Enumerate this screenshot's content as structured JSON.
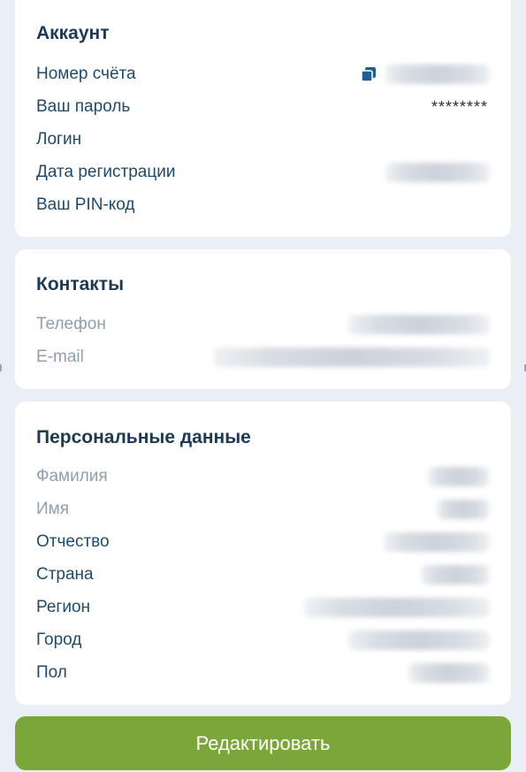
{
  "account": {
    "title": "Аккаунт",
    "rows": [
      {
        "label": "Номер счёта",
        "value": ""
      },
      {
        "label": "Ваш пароль",
        "value": "********"
      },
      {
        "label": "Логин",
        "value": ""
      },
      {
        "label": "Дата регистрации",
        "value": ""
      },
      {
        "label": "Ваш PIN-код",
        "value": ""
      }
    ]
  },
  "contacts": {
    "title": "Контакты",
    "rows": [
      {
        "label": "Телефон",
        "value": ""
      },
      {
        "label": "E-mail",
        "value": ""
      }
    ]
  },
  "personal": {
    "title": "Персональные данные",
    "rows": [
      {
        "label": "Фамилия",
        "value": ""
      },
      {
        "label": "Имя",
        "value": ""
      },
      {
        "label": "Отчество",
        "value": ""
      },
      {
        "label": "Страна",
        "value": ""
      },
      {
        "label": "Регион",
        "value": ""
      },
      {
        "label": "Город",
        "value": ""
      },
      {
        "label": "Пол",
        "value": ""
      }
    ]
  },
  "actions": {
    "edit_label": "Редактировать"
  },
  "colors": {
    "accent": "#7ba73a",
    "title": "#1d3a54",
    "label": "#1f4a6b",
    "muted_label": "#8f9faf",
    "background": "#e9eff4"
  },
  "icons": {
    "copy": "copy-icon"
  }
}
